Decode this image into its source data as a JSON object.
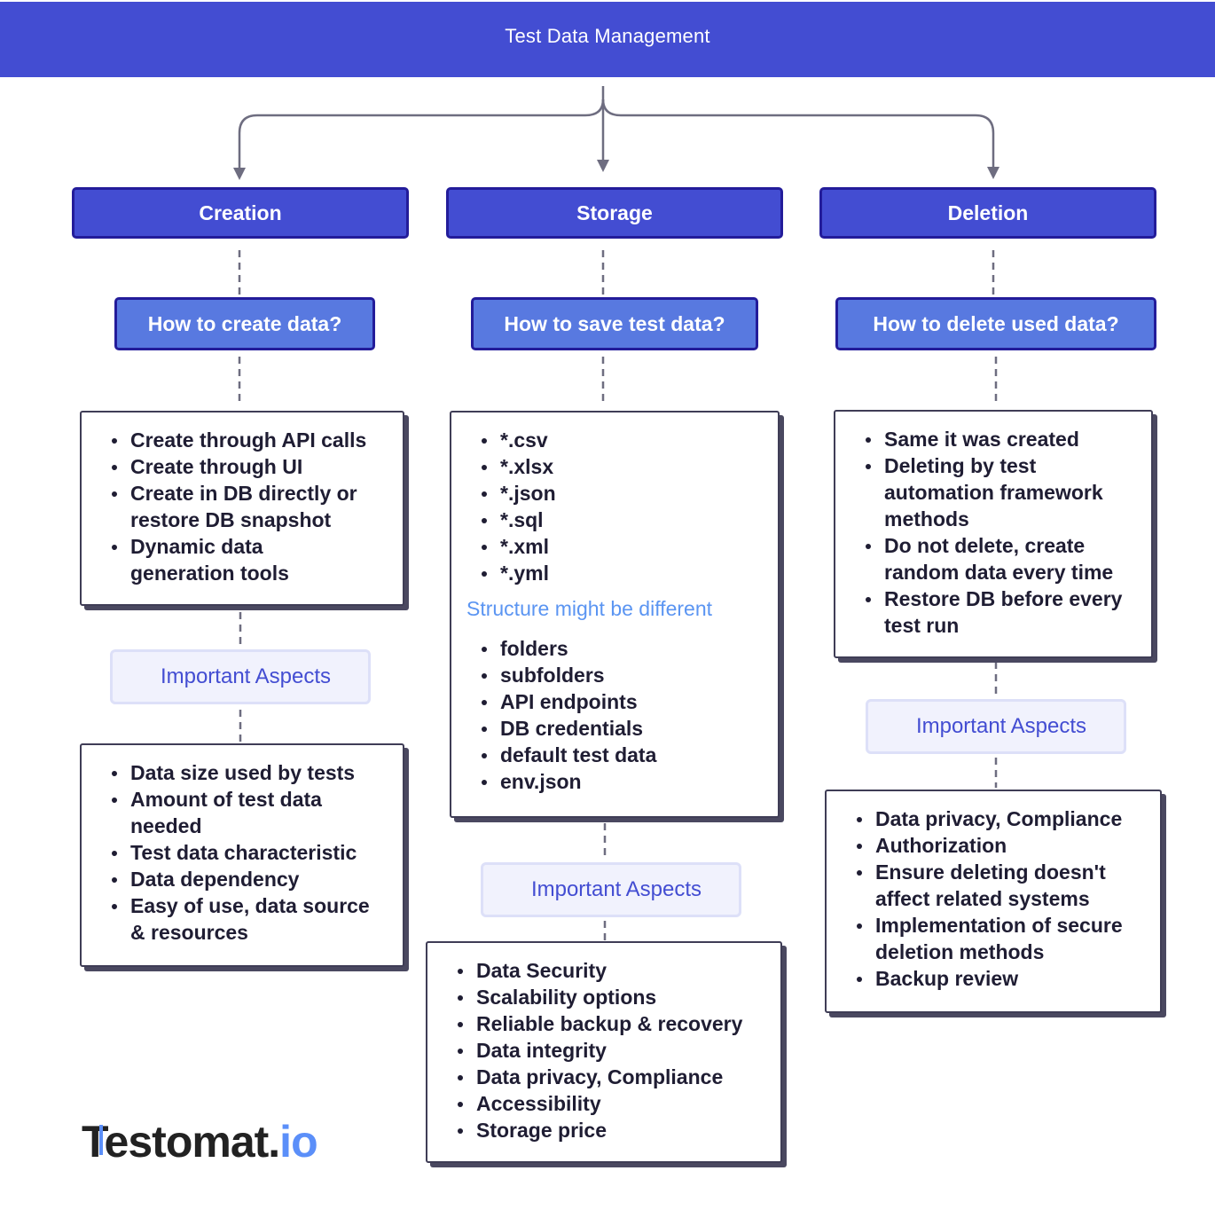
{
  "header": {
    "title": "Test Data Management"
  },
  "colors": {
    "header_bg": "#434dd2",
    "category_bg": "#434dd2",
    "category_border": "#231c9a",
    "question_bg": "#5879e0",
    "aspect_bg": "#f1f2fd",
    "aspect_text": "#434dd2",
    "structure_note": "#5b95f2",
    "connector": "#6e6d80",
    "logo_accent": "#5b8ff9"
  },
  "columns": [
    {
      "category": "Creation",
      "question": "How to create data?",
      "items": [
        "Create through API calls",
        "Create through UI",
        "Create in DB directly or restore DB snapshot",
        "Dynamic data generation tools"
      ],
      "aspects_label": "Important Aspects",
      "aspects": [
        "Data size used by tests",
        "Amount of test data needed",
        "Test data characteristic",
        "Data dependency",
        "Easy of use, data source & resources"
      ]
    },
    {
      "category": "Storage",
      "question": "How to save test data?",
      "items": [
        "*.csv",
        "*.xlsx",
        "*.json",
        "*.sql",
        "*.xml",
        "*.yml"
      ],
      "structure_note": "Structure might be different",
      "structure_items": [
        "folders",
        "subfolders",
        "API endpoints",
        "DB credentials",
        "default test data",
        "env.json"
      ],
      "aspects_label": "Important Aspects",
      "aspects": [
        "Data Security",
        "Scalability options",
        "Reliable backup & recovery",
        "Data integrity",
        "Data privacy, Compliance",
        "Accessibility",
        "Storage price"
      ]
    },
    {
      "category": "Deletion",
      "question": "How to delete used data?",
      "items": [
        "Same it was created",
        "Deleting by test automation framework methods",
        "Do not delete, create random data every time",
        "Restore DB before every test run"
      ],
      "aspects_label": "Important Aspects",
      "aspects": [
        "Data privacy, Compliance",
        "Authorization",
        "Ensure deleting doesn't affect related systems",
        "Implementation of secure deletion methods",
        "Backup review"
      ]
    }
  ],
  "logo": {
    "main": "estomat.",
    "suffix": "io",
    "prefix": "T"
  }
}
